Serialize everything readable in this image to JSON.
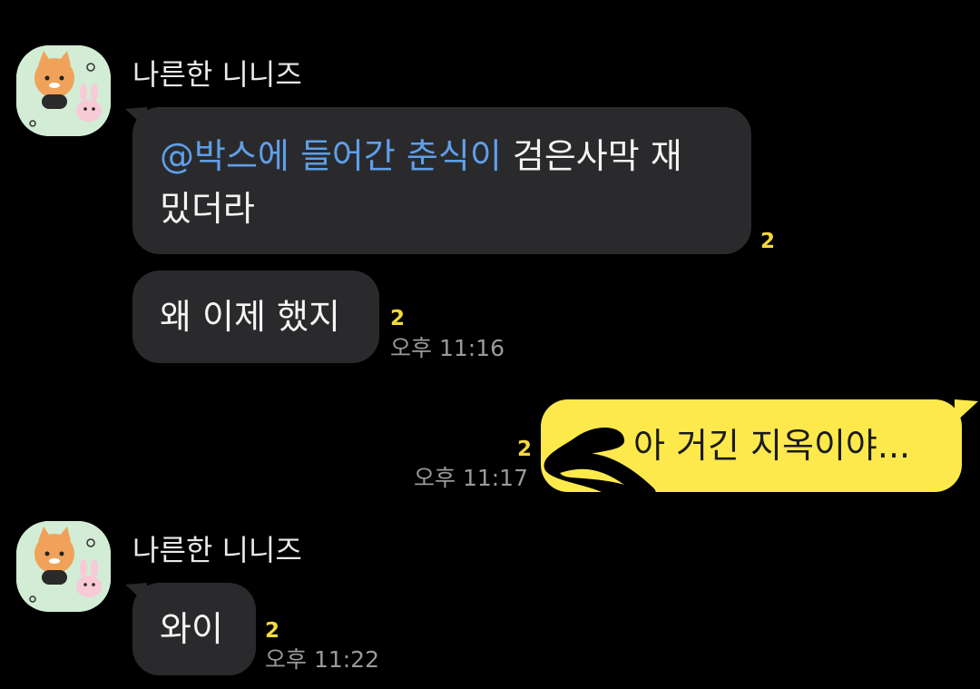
{
  "messages": [
    {
      "sender": "나른한 니니즈",
      "bubbles": [
        {
          "mention": "@박스에 들어간 춘식이",
          "text_line1": " 검은사막 재",
          "text_line2": "밌더라",
          "unread": "2"
        },
        {
          "text": "왜 이제 했지",
          "unread": "2",
          "time": "오후 11:16"
        }
      ]
    },
    {
      "mine": true,
      "text": "아 거긴 지옥이야...",
      "unread": "2",
      "time": "오후 11:17"
    },
    {
      "sender": "나른한 니니즈",
      "bubbles": [
        {
          "text": "와이",
          "unread": "2",
          "time": "오후 11:22"
        }
      ]
    }
  ],
  "colors": {
    "background": "#000000",
    "bubble_other": "#2a2a2c",
    "bubble_mine": "#fee94c",
    "mention": "#5f9fe8",
    "unread": "#f5d93a",
    "timestamp": "#9a9a9a"
  },
  "icons": {
    "avatar": "ninize-profile-avatar",
    "redaction": "black-scribble"
  }
}
